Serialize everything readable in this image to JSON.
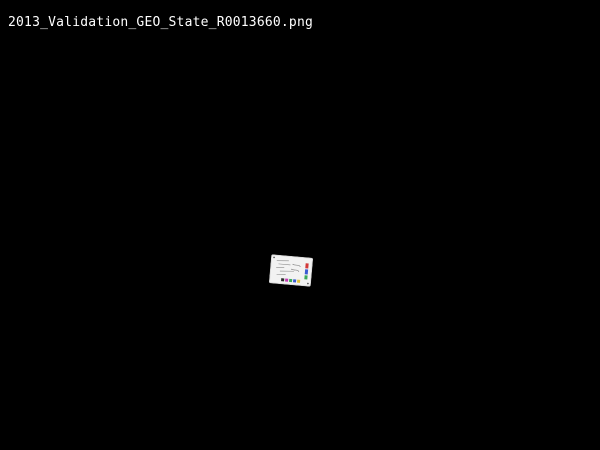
{
  "window": {
    "filename": "2013_Validation_GEO_State_R0013660.png"
  },
  "image": {
    "subject": "photo-card",
    "background_color": "#000000",
    "card_colors": {
      "paper": "#f2f2f2",
      "border": "#d9d9d9",
      "red": "#d23a3a",
      "green": "#3aa85a",
      "blue": "#3a5bd2",
      "yellow": "#e0c23a",
      "magenta": "#c23ab2",
      "dark": "#2a2a2a"
    }
  }
}
